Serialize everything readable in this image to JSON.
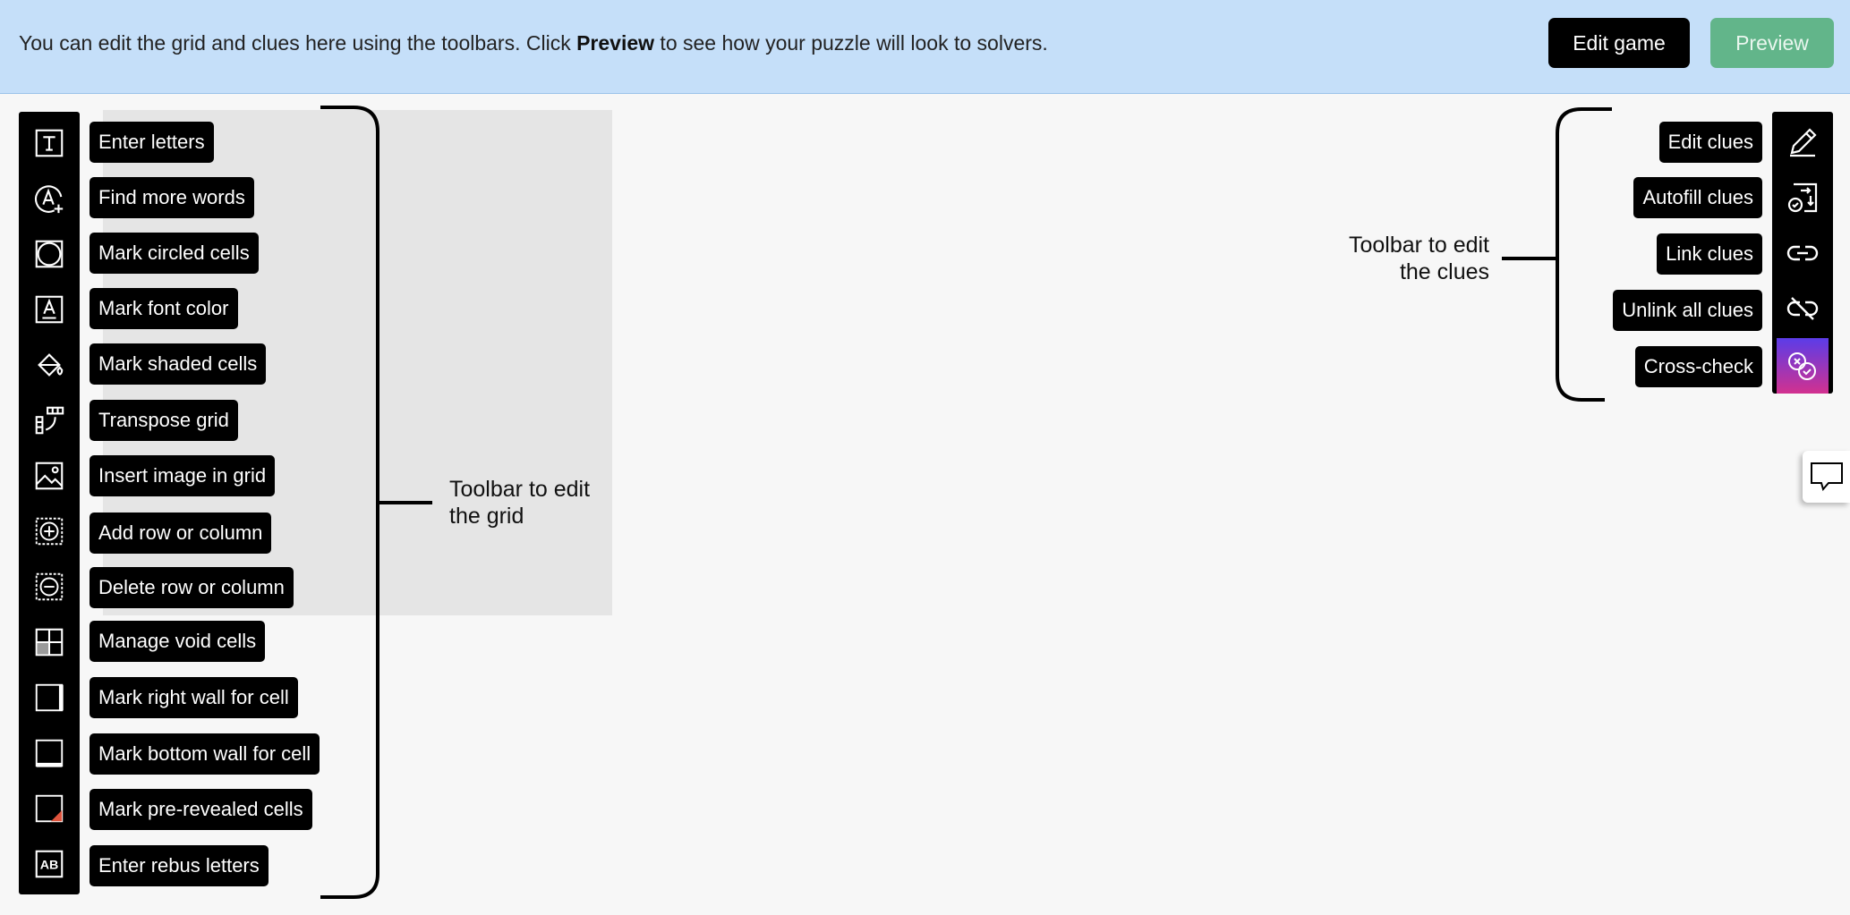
{
  "banner": {
    "text_before": "You can edit the grid and clues here using the toolbars. Click ",
    "text_bold": "Preview",
    "text_after": " to see how your puzzle will look to solvers.",
    "edit_game_label": "Edit game",
    "preview_label": "Preview"
  },
  "grid_toolbar": {
    "annotation": [
      "Toolbar to edit",
      "the grid"
    ],
    "items": [
      {
        "label": "Enter letters",
        "icon": "text-letter-icon"
      },
      {
        "label": "Find more words",
        "icon": "find-words-icon"
      },
      {
        "label": "Mark circled cells",
        "icon": "circled-cell-icon"
      },
      {
        "label": "Mark font color",
        "icon": "font-color-icon"
      },
      {
        "label": "Mark shaded cells",
        "icon": "paint-bucket-icon"
      },
      {
        "label": "Transpose grid",
        "icon": "transpose-icon"
      },
      {
        "label": "Insert image in grid",
        "icon": "image-icon"
      },
      {
        "label": "Add row or column",
        "icon": "add-row-column-icon"
      },
      {
        "label": "Delete row or column",
        "icon": "delete-row-column-icon"
      },
      {
        "label": "Manage void cells",
        "icon": "void-cells-icon"
      },
      {
        "label": "Mark right wall for cell",
        "icon": "right-wall-icon"
      },
      {
        "label": "Mark bottom wall for cell",
        "icon": "bottom-wall-icon"
      },
      {
        "label": "Mark pre-revealed cells",
        "icon": "pre-revealed-icon"
      },
      {
        "label": "Enter rebus letters",
        "icon": "rebus-icon"
      }
    ]
  },
  "clue_toolbar": {
    "annotation": [
      "Toolbar to edit",
      "the clues"
    ],
    "items": [
      {
        "label": "Edit clues",
        "icon": "pencil-icon"
      },
      {
        "label": "Autofill clues",
        "icon": "autofill-icon"
      },
      {
        "label": "Link clues",
        "icon": "link-icon"
      },
      {
        "label": "Unlink all clues",
        "icon": "unlink-icon"
      },
      {
        "label": "Cross-check",
        "icon": "cross-check-icon"
      }
    ]
  },
  "colors": {
    "banner_bg": "#c5dff9",
    "preview_button": "#62b58a",
    "cross_check_gradient": [
      "#5b3ce8",
      "#d2318f"
    ],
    "pre_revealed_corner": "#e0543d"
  }
}
